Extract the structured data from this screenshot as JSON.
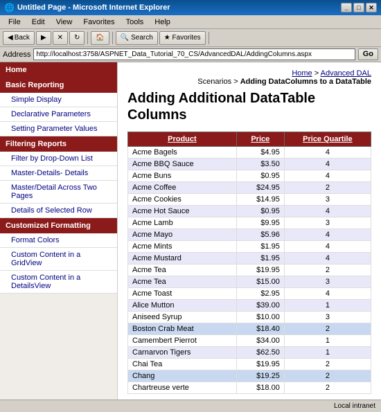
{
  "titleBar": {
    "title": "Untitled Page - Microsoft Internet Explorer",
    "icon": "🌐"
  },
  "menuBar": {
    "items": [
      "File",
      "Edit",
      "View",
      "Favorites",
      "Tools",
      "Help"
    ]
  },
  "addressBar": {
    "label": "Address",
    "url": "http://localhost:3758/ASPNET_Data_Tutorial_70_CS/AdvancedDAL/AddingColumns.aspx",
    "goLabel": "Go"
  },
  "breadcrumb": {
    "home": "Home",
    "section": "Advanced DAL",
    "separator1": " > ",
    "scenarios": "Scenarios",
    "separator2": " > ",
    "current": "Adding DataColumns to a DataTable"
  },
  "pageTitle": "Adding Additional DataTable Columns",
  "sidebar": {
    "sections": [
      {
        "label": "Home",
        "type": "header",
        "items": []
      },
      {
        "label": "Basic Reporting",
        "type": "header",
        "items": [
          "Simple Display",
          "Declarative Parameters",
          "Setting Parameter Values"
        ]
      },
      {
        "label": "Filtering Reports",
        "type": "header",
        "items": [
          "Filter by Drop-Down List",
          "Master-Details- Details",
          "Master/Detail Across Two Pages",
          "Details of Selected Row"
        ]
      },
      {
        "label": "Customized Formatting",
        "type": "header",
        "items": [
          "Format Colors",
          "Custom Content in a GridView",
          "Custom Content in a DetailsView"
        ]
      }
    ]
  },
  "table": {
    "headers": [
      "Product",
      "Price",
      "Price Quartile"
    ],
    "rows": [
      {
        "product": "Acme Bagels",
        "price": "$4.95",
        "quartile": "4"
      },
      {
        "product": "Acme BBQ Sauce",
        "price": "$3.50",
        "quartile": "4"
      },
      {
        "product": "Acme Buns",
        "price": "$0.95",
        "quartile": "4"
      },
      {
        "product": "Acme Coffee",
        "price": "$24.95",
        "quartile": "2"
      },
      {
        "product": "Acme Cookies",
        "price": "$14.95",
        "quartile": "3"
      },
      {
        "product": "Acme Hot Sauce",
        "price": "$0.95",
        "quartile": "4"
      },
      {
        "product": "Acme Lamb",
        "price": "$9.95",
        "quartile": "3"
      },
      {
        "product": "Acme Mayo",
        "price": "$5.96",
        "quartile": "4"
      },
      {
        "product": "Acme Mints",
        "price": "$1.95",
        "quartile": "4"
      },
      {
        "product": "Acme Mustard",
        "price": "$1.95",
        "quartile": "4"
      },
      {
        "product": "Acme Tea",
        "price": "$19.95",
        "quartile": "2"
      },
      {
        "product": "Acme Tea",
        "price": "$15.00",
        "quartile": "3"
      },
      {
        "product": "Acme Toast",
        "price": "$2.95",
        "quartile": "4"
      },
      {
        "product": "Alice Mutton",
        "price": "$39.00",
        "quartile": "1"
      },
      {
        "product": "Aniseed Syrup",
        "price": "$10.00",
        "quartile": "3"
      },
      {
        "product": "Boston Crab Meat",
        "price": "$18.40",
        "quartile": "2",
        "highlight": true
      },
      {
        "product": "Camembert Pierrot",
        "price": "$34.00",
        "quartile": "1"
      },
      {
        "product": "Carnarvon Tigers",
        "price": "$62.50",
        "quartile": "1"
      },
      {
        "product": "Chai Tea",
        "price": "$19.95",
        "quartile": "2"
      },
      {
        "product": "Chang",
        "price": "$19.25",
        "quartile": "2",
        "highlight": true
      },
      {
        "product": "Chartreuse verte",
        "price": "$18.00",
        "quartile": "2"
      }
    ]
  },
  "statusBar": {
    "text": "Local intranet"
  }
}
